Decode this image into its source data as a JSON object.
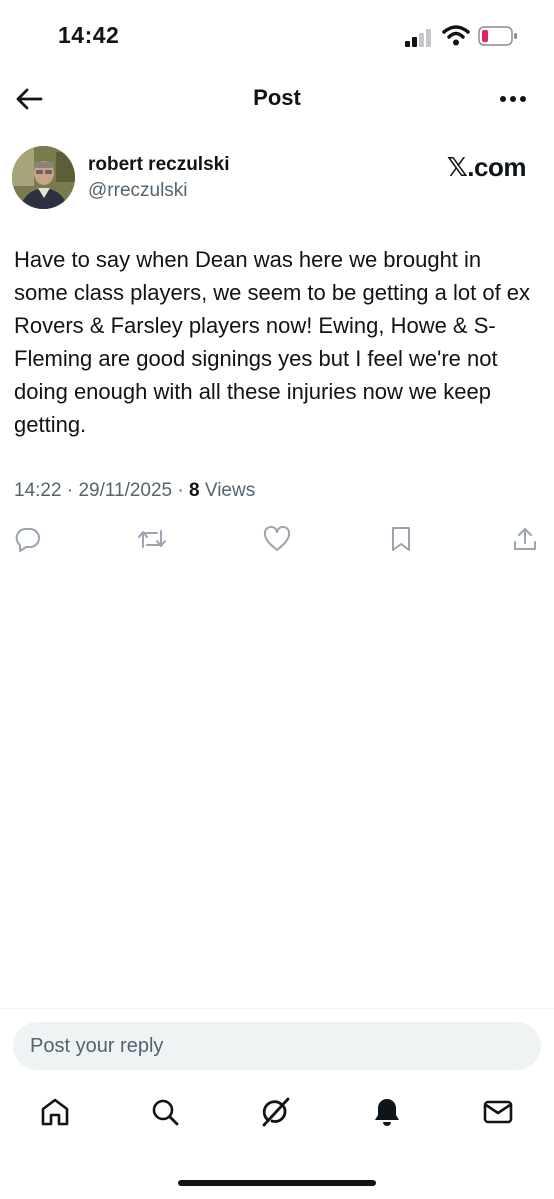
{
  "status_bar": {
    "time": "14:42"
  },
  "nav": {
    "title": "Post"
  },
  "post": {
    "author_name": "robert reczulski",
    "author_handle": "@rreczulski",
    "source_label": "𝕏.com",
    "text": "Have to say when Dean was here we brought in some class players, we seem to be getting a lot of ex Rovers & Farsley players now! Ewing, Howe & S-Fleming are good signings yes but I feel we're not doing enough with all these injuries now we keep getting.",
    "time": "14:22",
    "date": "29/11/2025",
    "views_count": "8",
    "views_label": "Views"
  },
  "reply": {
    "placeholder": "Post your reply"
  },
  "icons": {
    "back": "arrow-left-icon",
    "more": "more-horizontal-icon",
    "reply": "comment-icon",
    "repost": "repost-icon",
    "like": "heart-icon",
    "bookmark": "bookmark-icon",
    "share": "share-icon",
    "home": "home-icon",
    "search": "search-icon",
    "grok": "grok-icon",
    "notifications": "bell-icon",
    "messages": "mail-icon"
  },
  "colors": {
    "text_primary": "#0f1419",
    "text_secondary": "#536471",
    "icon_muted": "#9aa5b1",
    "battery_low": "#e0245e",
    "reply_bg": "#eff3f4"
  }
}
